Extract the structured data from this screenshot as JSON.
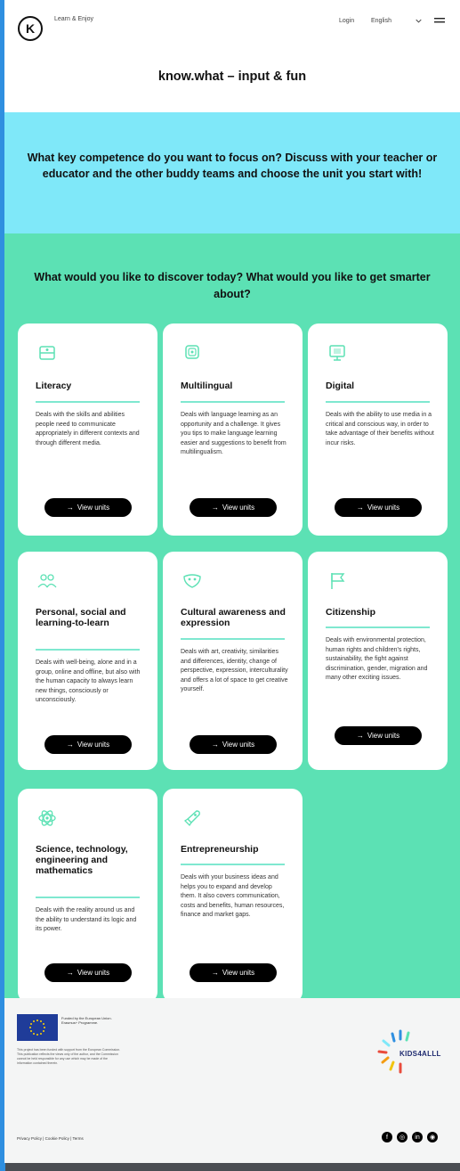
{
  "header": {
    "logo_letter": "K",
    "brand_text": "Learn & Enjoy",
    "login_label": "Login",
    "language_label": "English",
    "page_title": "know.what – input & fun"
  },
  "focus_question": "What key competence do you want to focus on? Discuss with your teacher or educator and the other buddy teams and choose the unit you start with!",
  "discover_question": "What would you like to discover today? What would you like to get smarter about?",
  "cards": [
    {
      "title": "Literacy",
      "description": "Deals with the skills and abilities people need to communicate appropriately in different contexts and through different media.",
      "button": "View units",
      "icon": "book-icon"
    },
    {
      "title": "Multilingual",
      "description": "Deals with language learning as an opportunity and a challenge. It gives you tips to make language learning easier and suggestions to benefit from multilingualism.",
      "button": "View units",
      "icon": "speech-icon"
    },
    {
      "title": "Digital",
      "description": "Deals with the ability to use media in a critical and conscious way, in order to take advantage of their benefits without incur risks.",
      "button": "View units",
      "icon": "monitor-icon"
    },
    {
      "title": "Personal, social and learning-to-learn",
      "description": "Deals with well-being, alone and in a group, online and offline, but also with the human capacity to always learn new things, consciously or unconsciously.",
      "button": "View units",
      "icon": "people-icon"
    },
    {
      "title": "Cultural awareness and expression",
      "description": "Deals with art, creativity, similarities and differences, identity, change of perspective, expression, interculturality and offers a lot of space to get creative yourself.",
      "button": "View units",
      "icon": "mask-icon"
    },
    {
      "title": "Citizenship",
      "description": "Deals with environmental protection, human rights and children's rights, sustainability, the fight against discrimination, gender, migration and many other exciting issues.",
      "button": "View units",
      "icon": "flag-icon"
    },
    {
      "title": "Science, technology, engineering and mathematics",
      "description": "Deals with the reality around us and the ability to understand its logic and its power.",
      "button": "View units",
      "icon": "atom-icon"
    },
    {
      "title": "Entrepreneurship",
      "description": "Deals with your business ideas and helps you to expand and develop them. It also covers communication, costs and benefits, human resources, finance and market gaps.",
      "button": "View units",
      "icon": "rocket-icon"
    }
  ],
  "footer": {
    "eu_text": "Funded by the European Union. Erasmus+ Programme.",
    "disclaimer": "This project has been funded with support from the European Commission. This publication reflects the views only of the author, and the Commission cannot be held responsible for any use which may be made of the information contained therein.",
    "partner_logo_text": "KIDS4ALLL",
    "privacy_text": "Privacy Policy | Cookie Policy | Terms",
    "social": [
      "facebook-icon",
      "instagram-icon",
      "linkedin-icon",
      "other-social-icon"
    ]
  },
  "colors": {
    "accent_blue": "#7fe8f9",
    "accent_green": "#5ce1b4",
    "button": "#000000",
    "divider": "#7fe8d0"
  }
}
